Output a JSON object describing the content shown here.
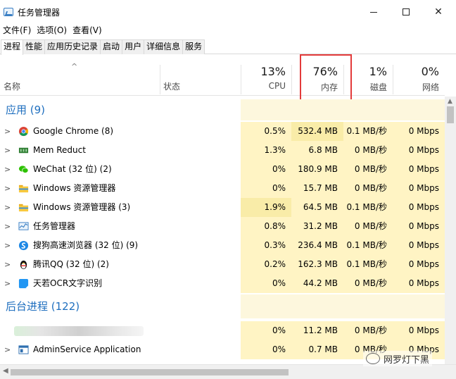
{
  "window": {
    "title": "任务管理器"
  },
  "menu": [
    "文件(F)",
    "选项(O)",
    "查看(V)"
  ],
  "tabs": [
    "进程",
    "性能",
    "应用历史记录",
    "启动",
    "用户",
    "详细信息",
    "服务"
  ],
  "header": {
    "name_label": "名称",
    "status_label": "状态",
    "cpu_pct": "13%",
    "cpu_label": "CPU",
    "mem_pct": "76%",
    "mem_label": "内存",
    "disk_pct": "1%",
    "disk_label": "磁盘",
    "net_pct": "0%",
    "net_label": "网络"
  },
  "groups": {
    "apps_title": "应用 (9)",
    "background_title": "后台进程 (122)"
  },
  "apps": [
    {
      "name": "Google Chrome (8)",
      "icon": "chrome-icon",
      "cpu": "0.5%",
      "mem": "532.4 MB",
      "disk": "0.1 MB/秒",
      "net": "0 Mbps"
    },
    {
      "name": "Mem Reduct",
      "icon": "memreduct-icon",
      "cpu": "1.3%",
      "mem": "6.8 MB",
      "disk": "0 MB/秒",
      "net": "0 Mbps"
    },
    {
      "name": "WeChat (32 位) (2)",
      "icon": "wechat-icon",
      "cpu": "0%",
      "mem": "180.9 MB",
      "disk": "0 MB/秒",
      "net": "0 Mbps"
    },
    {
      "name": "Windows 资源管理器",
      "icon": "folder-icon",
      "cpu": "0%",
      "mem": "15.7 MB",
      "disk": "0 MB/秒",
      "net": "0 Mbps"
    },
    {
      "name": "Windows 资源管理器 (3)",
      "icon": "folder-icon",
      "cpu": "1.9%",
      "mem": "64.5 MB",
      "disk": "0.1 MB/秒",
      "net": "0 Mbps"
    },
    {
      "name": "任务管理器",
      "icon": "taskmgr-icon",
      "cpu": "0.8%",
      "mem": "31.2 MB",
      "disk": "0 MB/秒",
      "net": "0 Mbps"
    },
    {
      "name": "搜狗高速浏览器 (32 位) (9)",
      "icon": "sogou-browser-icon",
      "cpu": "0.3%",
      "mem": "236.4 MB",
      "disk": "0.1 MB/秒",
      "net": "0 Mbps"
    },
    {
      "name": "腾讯QQ (32 位) (2)",
      "icon": "qq-penguin-icon",
      "cpu": "0.2%",
      "mem": "162.3 MB",
      "disk": "0.1 MB/秒",
      "net": "0 Mbps"
    },
    {
      "name": "天若OCR文字识别",
      "icon": "ocr-icon",
      "cpu": "0%",
      "mem": "44.2 MB",
      "disk": "0 MB/秒",
      "net": "0 Mbps"
    }
  ],
  "background": [
    {
      "name": "",
      "icon": "",
      "cpu": "0%",
      "mem": "11.2 MB",
      "disk": "0 MB/秒",
      "net": "0 Mbps"
    },
    {
      "name": "AdminService Application",
      "icon": "service-app-icon",
      "cpu": "0%",
      "mem": "0.7 MB",
      "disk": "0 MB/秒",
      "net": "0 Mbps"
    }
  ],
  "watermark": "网罗灯下黑",
  "colors": {
    "group_title": "#1f6fbf",
    "highlight_border": "#e33b3b",
    "heat_light": "#fff4c4",
    "heat_mid": "#f9eca8"
  }
}
